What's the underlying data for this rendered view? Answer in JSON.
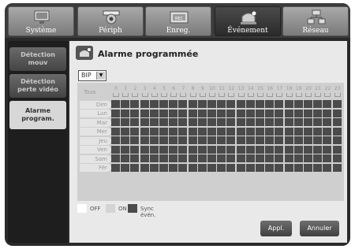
{
  "tabs": [
    {
      "label": "Système",
      "icon": "monitor-icon",
      "active": false
    },
    {
      "label": "Périph",
      "icon": "camera-icon",
      "active": false
    },
    {
      "label": "Enreg.",
      "icon": "recorder-icon",
      "active": false
    },
    {
      "label": "Événement",
      "icon": "alarm-icon",
      "active": true
    },
    {
      "label": "Réseau",
      "icon": "network-icon",
      "active": false
    }
  ],
  "sidebar": {
    "items": [
      {
        "label_line1": "Détection",
        "label_line2": "mouv",
        "active": false
      },
      {
        "label_line1": "Détection",
        "label_line2": "perte vidéo",
        "active": false
      },
      {
        "label_line1": "Alarme",
        "label_line2": "program.",
        "active": true
      }
    ]
  },
  "main": {
    "title": "Alarme programmée",
    "title_icon": "alarm-icon",
    "select_value": "BIP",
    "all_label": "Tous",
    "hours": [
      "0",
      "1",
      "2",
      "3",
      "4",
      "5",
      "6",
      "7",
      "8",
      "9",
      "10",
      "11",
      "12",
      "13",
      "14",
      "15",
      "16",
      "17",
      "18",
      "19",
      "20",
      "21",
      "22",
      "23"
    ],
    "days": [
      "Dim",
      "Lun",
      "Mar",
      "Mer",
      "Jeu",
      "Ven",
      "Sam",
      "Fér"
    ],
    "schedule_state": "Sync évén."
  },
  "legend": {
    "off_label": "OFF",
    "on_label": "ON",
    "sync_label": "Sync évén.",
    "off_color": "#ffffff",
    "on_color": "#d4d4d4",
    "sync_color": "#4b4b4b"
  },
  "buttons": {
    "apply_label": "Appl.",
    "cancel_label": "Annuler"
  }
}
